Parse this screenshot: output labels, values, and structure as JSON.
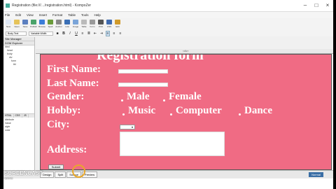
{
  "window": {
    "title": "Registration (file:///…/registration.html) - KompoZer"
  },
  "menu": [
    "File",
    "Edit",
    "View",
    "Insert",
    "Format",
    "Table",
    "Tools",
    "Help"
  ],
  "toolbar": [
    {
      "label": "New",
      "color": "#dfe8f5",
      "icon": "new-icon"
    },
    {
      "label": "Open",
      "color": "#e6c35a",
      "icon": "open-icon"
    },
    {
      "label": "Save",
      "color": "#5b7fc0",
      "icon": "save-icon"
    },
    {
      "label": "Publish",
      "color": "#4aa36a",
      "icon": "publish-icon"
    },
    {
      "label": "Browse",
      "color": "#3b7dd8",
      "icon": "browse-icon"
    },
    {
      "label": "Spell",
      "color": "#6a9b3a",
      "icon": "spell-icon"
    },
    {
      "label": "Anchor",
      "color": "#888",
      "icon": "anchor-icon"
    },
    {
      "label": "Link",
      "color": "#3a6fb5",
      "icon": "link-icon"
    },
    {
      "label": "Image",
      "color": "#7aa4d8",
      "icon": "image-icon"
    },
    {
      "label": "Table",
      "color": "#bbb",
      "icon": "table-icon"
    },
    {
      "label": "Form",
      "color": "#999",
      "icon": "form-icon"
    },
    {
      "label": "Print",
      "color": "#555",
      "icon": "print-icon"
    },
    {
      "label": "CSS",
      "color": "#3f6bb0",
      "icon": "css-icon"
    },
    {
      "label": "Edit",
      "color": "#d09a2a",
      "icon": "edit-icon"
    }
  ],
  "format": {
    "style": "Body Text",
    "font": "Variable Width"
  },
  "sidebar": {
    "site_manager": "Site Manager",
    "dom_explorer": "DOM Explorer",
    "tree": [
      "html",
      "head",
      "body",
      "div",
      "form",
      "tbl"
    ],
    "tabs": [
      "HTML",
      "CSS",
      "JS"
    ],
    "attr_rows": [
      "Attribute",
      "Value",
      "style",
      "color"
    ]
  },
  "ruler": {
    "label": "<div>"
  },
  "form": {
    "heading": "Registration form",
    "first_name": "First Name:",
    "last_name": "Last Name:",
    "gender": "Gender:",
    "male": "Male",
    "female": "Female",
    "hobby": "Hobby:",
    "music": "Music",
    "computer": "Computer",
    "dance": "Dance",
    "city": "City:",
    "address": "Address:",
    "submit": "Submit"
  },
  "views": [
    "Design",
    "Split",
    "Source",
    "Preview"
  ],
  "status": {
    "zoom": "Normal"
  },
  "watermark": {
    "top": "SCREENCAST",
    "bottom": "MATIC"
  }
}
